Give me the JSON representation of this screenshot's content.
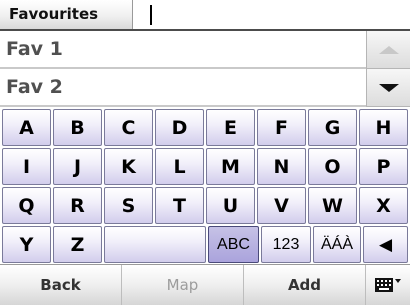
{
  "titlebar": {
    "title": "Favourites",
    "input_value": ""
  },
  "list": {
    "items": [
      {
        "label": "Fav 1"
      },
      {
        "label": "Fav 2"
      }
    ],
    "scroll_up_icon": "triangle-up-icon",
    "scroll_down_icon": "triangle-down-icon"
  },
  "keyboard": {
    "rows": [
      [
        "A",
        "B",
        "C",
        "D",
        "E",
        "F",
        "G",
        "H"
      ],
      [
        "I",
        "J",
        "K",
        "L",
        "M",
        "N",
        "O",
        "P"
      ],
      [
        "Q",
        "R",
        "S",
        "T",
        "U",
        "V",
        "W",
        "X"
      ]
    ],
    "last_row": {
      "keys": [
        "Y",
        "Z"
      ],
      "mode_abc": "ABC",
      "mode_123": "123",
      "mode_accents": "ÄÁÀ",
      "backspace": "◀"
    },
    "active_mode": "ABC"
  },
  "bottombar": {
    "back_label": "Back",
    "map_label": "Map",
    "add_label": "Add",
    "keyboard_icon": "keyboard-icon"
  },
  "colors": {
    "key_gradient_bottom": "#d2cdec",
    "active_key": "#aaa3dc",
    "list_text": "#505050"
  }
}
